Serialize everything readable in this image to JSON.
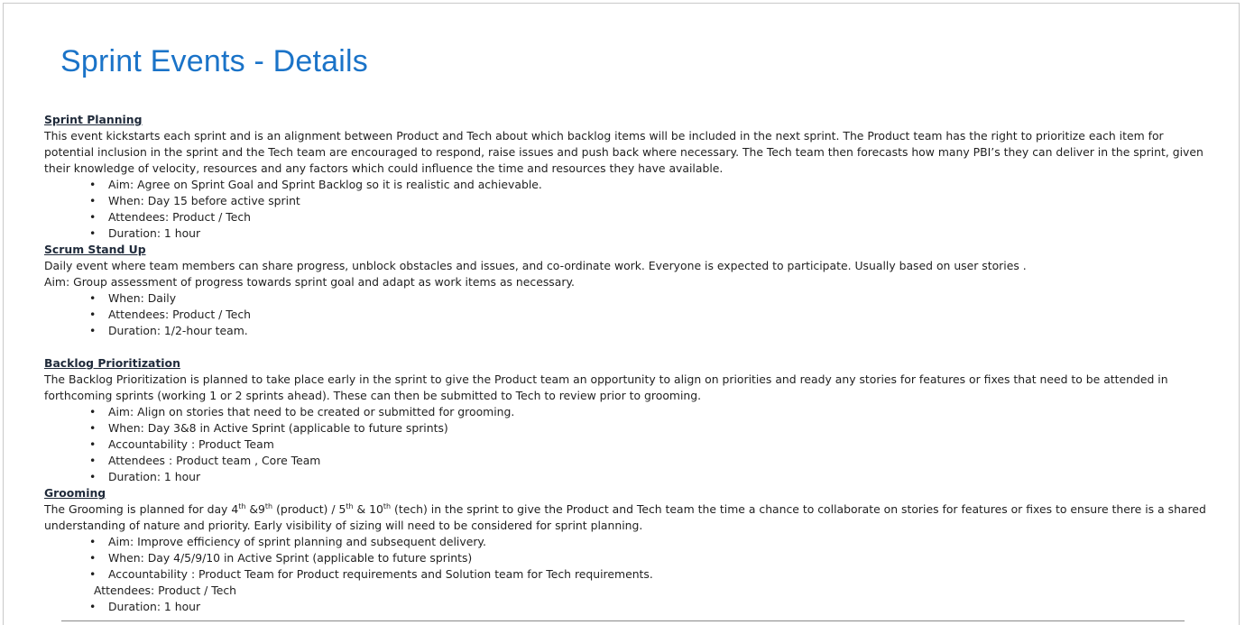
{
  "title": "Sprint Events - Details",
  "planning": {
    "heading": "Sprint Planning",
    "text": "This event kickstarts each sprint and is an alignment between Product and Tech about which backlog items will be included in the next sprint. The Product team has the right to prioritize each item for potential inclusion in the sprint and the Tech team are encouraged to respond, raise issues and push back where necessary. The Tech team then forecasts how many PBI’s they can deliver in the sprint, given their knowledge of velocity, resources and any factors which could influence the time and resources they have available.",
    "bullets": [
      "Aim: Agree on Sprint Goal and Sprint Backlog so it is realistic and achievable.",
      "When: Day 15 before active sprint",
      "Attendees: Product / Tech",
      "Duration: 1 hour"
    ]
  },
  "standup": {
    "heading": "Scrum Stand Up",
    "text": "Daily event where team members can share progress, unblock obstacles and issues, and co-ordinate work. Everyone is expected to participate. Usually based  on user stories .",
    "aim": "Aim: Group assessment of progress towards sprint goal and adapt as work items as necessary.",
    "bullets": [
      "When: Daily",
      "Attendees: Product / Tech",
      "Duration: 1/2-hour team."
    ]
  },
  "backlog": {
    "heading": "Backlog Prioritization",
    "text": "The Backlog Prioritization is planned to take place early in the sprint to give the Product team an opportunity to align on priorities and ready any stories for features or fixes that need to be attended in forthcoming sprints (working 1 or 2 sprints ahead). These can then be submitted to Tech to review prior to grooming.",
    "bullets": [
      "Aim: Align on stories that need to be created or submitted for grooming.",
      "When: Day 3&8 in Active Sprint (applicable to future sprints)",
      "Accountability : Product Team",
      "Attendees : Product team , Core Team",
      "Duration: 1 hour"
    ]
  },
  "grooming": {
    "heading": "Grooming",
    "t1": "The Grooming is planned for day 4",
    "s1": "th",
    "t2": " &9",
    "s2": "th",
    "t3": " (product) / 5",
    "s3": "th",
    "t4": " & 10",
    "s4": "th",
    "t5": " (tech)  in the sprint to give the Product and Tech team the time a chance to collaborate on stories for features or fixes to ensure there is a shared understanding of nature and priority. Early visibility of sizing will need to be considered for sprint planning.",
    "bullets": [
      "Aim: Improve efficiency of sprint planning and subsequent delivery.",
      "When: Day 4/5/9/10  in Active Sprint (applicable to future sprints)",
      "Accountability : Product Team for Product requirements and Solution team for Tech requirements."
    ],
    "attendees": "Attendees: Product / Tech",
    "duration": "Duration: 1 hour"
  }
}
